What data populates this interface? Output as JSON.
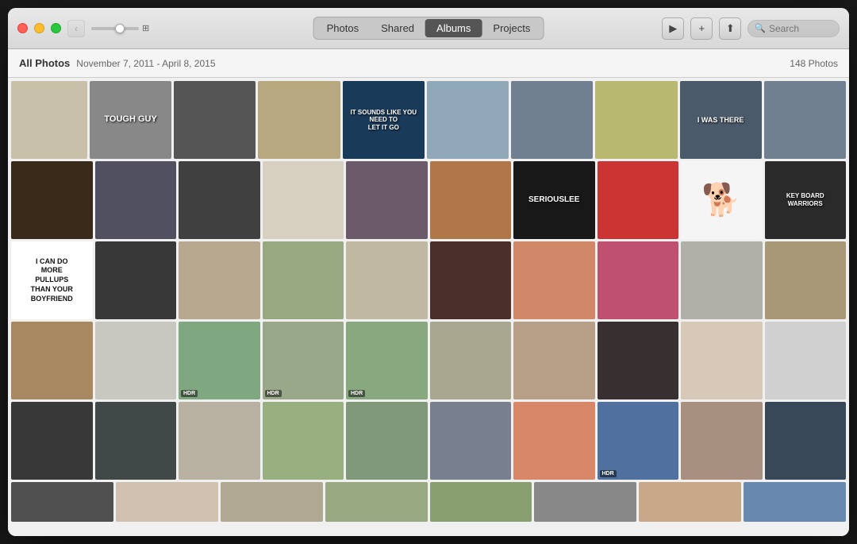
{
  "window": {
    "title": "Photos"
  },
  "titlebar": {
    "back_label": "‹",
    "forward_label": "›"
  },
  "tabs": [
    {
      "id": "photos",
      "label": "Photos",
      "active": false
    },
    {
      "id": "shared",
      "label": "Shared",
      "active": false
    },
    {
      "id": "albums",
      "label": "Albums",
      "active": true
    },
    {
      "id": "projects",
      "label": "Projects",
      "active": false
    }
  ],
  "toolbar": {
    "all_photos": "All Photos",
    "date_range": "November 7, 2011 - April 8, 2015",
    "photo_count": "148 Photos"
  },
  "search": {
    "placeholder": "Search"
  },
  "photos": {
    "rows": [
      {
        "cells": [
          {
            "color": "#d0c8b8",
            "text": "",
            "bg": "#c8c0a8"
          },
          {
            "color": "#3a3a3a",
            "text": "TOUGH GUY",
            "bg": "#888"
          },
          {
            "color": "#404040",
            "text": "",
            "bg": "#555"
          },
          {
            "color": "#c8b890",
            "text": "",
            "bg": "#b8a880"
          },
          {
            "color": "#2a4a6a",
            "text": "IT SOUNDS LIKE YOU NEED TO\nLET IT GO",
            "bg": "#1a3a5a",
            "textColor": "white"
          },
          {
            "color": "#a8b8c8",
            "text": "",
            "bg": "#90a8b8"
          },
          {
            "color": "#808890",
            "text": "",
            "bg": "#708090"
          },
          {
            "color": "#c8c890",
            "text": "",
            "bg": "#b8b870"
          },
          {
            "color": "#2a3a4a",
            "text": "I WAS THERE",
            "bg": "#4a5a6a",
            "textColor": "white"
          },
          {
            "color": "#8090a0",
            "text": "",
            "bg": "#708090"
          }
        ]
      },
      {
        "cells": [
          {
            "color": "#2a1a0a",
            "text": "",
            "bg": "#3a2a1a"
          },
          {
            "color": "#404050",
            "text": "",
            "bg": "#505060"
          },
          {
            "color": "#303030",
            "text": "",
            "bg": "#404040"
          },
          {
            "color": "#e8e0d0",
            "text": "",
            "bg": "#d8d0c0"
          },
          {
            "color": "#5a4a5a",
            "text": "",
            "bg": "#6a5a6a"
          },
          {
            "color": "#c08858",
            "text": "",
            "bg": "#b07848"
          },
          {
            "color": "#101010",
            "text": "SERIOUSLEE",
            "bg": "#181818",
            "textColor": "white"
          },
          {
            "color": "#cc2222",
            "text": "",
            "bg": "#cc3333"
          },
          {
            "color": "#f0f0f0",
            "text": "🐕",
            "bg": "#f5f5f5"
          },
          {
            "color": "#1a1a1a",
            "text": "KEY BOARD\nWARRIORS",
            "bg": "#2a2a2a",
            "textColor": "white"
          }
        ]
      },
      {
        "cells": [
          {
            "color": "#f0f0f0",
            "text": "I CAN DO\nMORE\nPULLUPS\nTHAN YOUR\nBOYFRIEND",
            "bg": "#ffffff",
            "textColor": "#222222"
          },
          {
            "color": "#282828",
            "text": "",
            "bg": "#383838"
          },
          {
            "color": "#c8b8a0",
            "text": "",
            "bg": "#b8a890"
          },
          {
            "color": "#a8b890",
            "text": "",
            "bg": "#98a880"
          },
          {
            "color": "#d0c8b0",
            "text": "",
            "bg": "#c0b8a0"
          },
          {
            "color": "#3a2018",
            "text": "",
            "bg": "#4a3028"
          },
          {
            "color": "#c87858",
            "text": "",
            "bg": "#d08868"
          },
          {
            "color": "#b04060",
            "text": "",
            "bg": "#c05070"
          },
          {
            "color": "#c0c0b8",
            "text": "",
            "bg": "#b0b0a8"
          },
          {
            "color": "#b8a888",
            "text": "",
            "bg": "#a89878"
          }
        ]
      },
      {
        "cells": [
          {
            "color": "#b89870",
            "text": "",
            "bg": "#a88860"
          },
          {
            "color": "#d8d8d0",
            "text": "",
            "bg": "#c8c8c0"
          },
          {
            "color": "#90b890",
            "text": "",
            "bg": "#80a880",
            "hdr": true
          },
          {
            "color": "#a8b898",
            "text": "",
            "bg": "#98a888",
            "hdr": true
          },
          {
            "color": "#98b890",
            "text": "",
            "bg": "#88a880",
            "hdr": true
          },
          {
            "color": "#b8b8a0",
            "text": "",
            "bg": "#a8a890"
          },
          {
            "color": "#c8b098",
            "text": "",
            "bg": "#b8a088"
          },
          {
            "color": "#282020",
            "text": "",
            "bg": "#383030"
          },
          {
            "color": "#e8d8c8",
            "text": "",
            "bg": "#d8c8b8"
          },
          {
            "color": "#e0e0e0",
            "text": "",
            "bg": "#d0d0d0"
          }
        ]
      },
      {
        "cells": [
          {
            "color": "#282828",
            "text": "",
            "bg": "#383838"
          },
          {
            "color": "#303838",
            "text": "",
            "bg": "#404848"
          },
          {
            "color": "#c8c0b0",
            "text": "",
            "bg": "#b8b0a0"
          },
          {
            "color": "#a8c090",
            "text": "",
            "bg": "#98b080"
          },
          {
            "color": "#90a888",
            "text": "",
            "bg": "#80987a"
          },
          {
            "color": "#8890a0",
            "text": "",
            "bg": "#788090"
          },
          {
            "color": "#f09878",
            "text": "",
            "bg": "#d88868"
          },
          {
            "color": "#6080a8",
            "text": "",
            "bg": "#5070a0",
            "hdr": true
          },
          {
            "color": "#b8a090",
            "text": "",
            "bg": "#a89080"
          },
          {
            "color": "#283848",
            "text": "",
            "bg": "#384858"
          }
        ]
      },
      {
        "cells": [
          {
            "color": "#404040",
            "text": "",
            "bg": "#505050"
          },
          {
            "color": "#e0d0c0",
            "text": "",
            "bg": "#d0c0b0",
            "partial": true
          }
        ]
      }
    ]
  }
}
